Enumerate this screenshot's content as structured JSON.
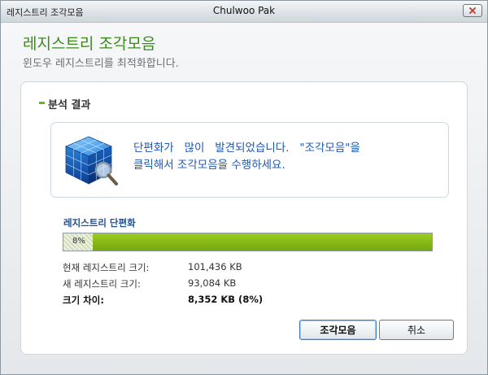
{
  "window": {
    "title": "레지스트리 조각모음",
    "user": "Chulwoo Pak"
  },
  "header": {
    "title": "레지스트리 조각모음",
    "subtitle": "윈도우 레지스트리를 최적화합니다."
  },
  "section": {
    "title": "분석 결과"
  },
  "message": {
    "line1": "단편화가   많이   발견되었습니다.   \"조각모음\"을",
    "line2": "클릭해서 조각모음을 수행하세요."
  },
  "progress": {
    "label": "레지스트리 단편화",
    "percent_text": "8%",
    "percent_value": 8
  },
  "stats": [
    {
      "label": "현재 레지스트리 크기:",
      "value": "101,436 KB"
    },
    {
      "label": "새 레지스트리 크기:",
      "value": "93,084 KB"
    },
    {
      "label": "크기 차이:",
      "value": "8,352 KB (8%)"
    }
  ],
  "buttons": {
    "defrag": "조각모음",
    "cancel": "취소"
  },
  "colors": {
    "accent_green": "#3b8a1c",
    "message_blue": "#1f57b4",
    "progress_green": "#8cc21a"
  }
}
